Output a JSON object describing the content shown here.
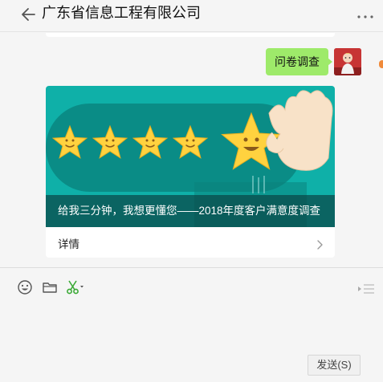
{
  "header": {
    "title": "广东省信息工程有限公司",
    "back_icon": "back-arrow-icon",
    "more_icon": "more-dots-icon"
  },
  "chat": {
    "outgoing_message": "问卷调查",
    "card": {
      "caption": "给我三分钟，我想更懂您——2018年度客户满意度调查",
      "detail_label": "详情",
      "detail_icon": "chevron-right-icon"
    }
  },
  "toolbar": {
    "icons": [
      "emoji-icon",
      "folder-icon",
      "scissors-icon",
      "history-icon"
    ],
    "send_label": "发送(S)"
  },
  "colors": {
    "bubble": "#9eea6a",
    "banner_teal": "#0fb0a8",
    "star_yellow": "#ffd23f",
    "scissors_green": "#3aa935"
  }
}
